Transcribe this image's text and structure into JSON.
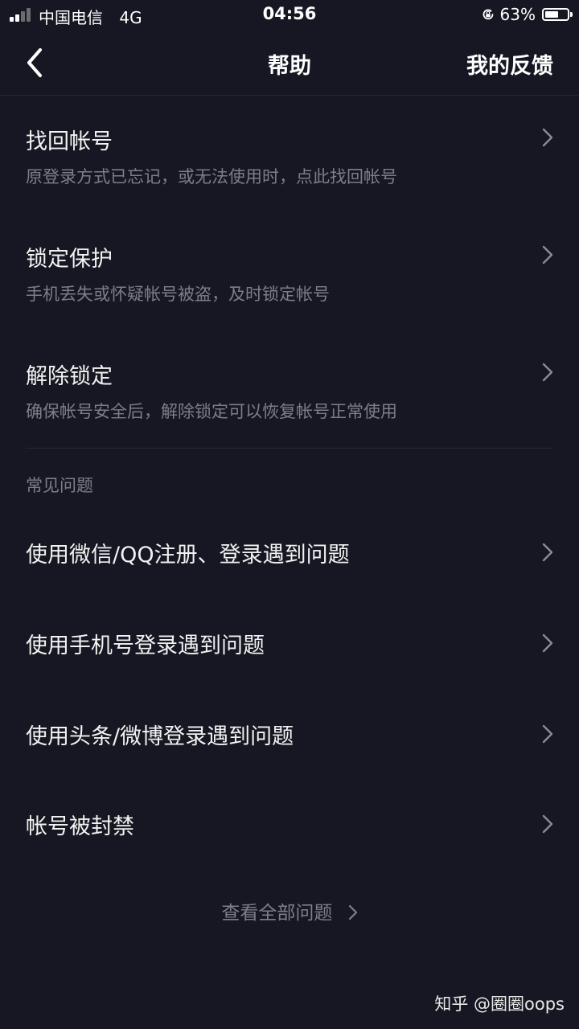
{
  "status_bar": {
    "carrier": "中国电信",
    "network": "4G",
    "time": "04:56",
    "battery_percent": "63%",
    "battery_level": 0.63,
    "signal_bars_active": 2,
    "signal_bars_total": 4
  },
  "nav": {
    "title": "帮助",
    "back_icon": "chevron-left-icon",
    "feedback_label": "我的反馈"
  },
  "account_items": [
    {
      "title": "找回帐号",
      "subtitle": "原登录方式已忘记，或无法使用时，点此找回帐号"
    },
    {
      "title": "锁定保护",
      "subtitle": "手机丢失或怀疑帐号被盗，及时锁定帐号"
    },
    {
      "title": "解除锁定",
      "subtitle": "确保帐号安全后，解除锁定可以恢复帐号正常使用"
    }
  ],
  "faq": {
    "header": "常见问题",
    "items": [
      {
        "title": "使用微信/QQ注册、登录遇到问题"
      },
      {
        "title": "使用手机号登录遇到问题"
      },
      {
        "title": "使用头条/微博登录遇到问题"
      },
      {
        "title": "帐号被封禁"
      }
    ]
  },
  "view_all_label": "查看全部问题",
  "watermark": "知乎 @圈圈oops",
  "colors": {
    "background": "#161722",
    "primary_text": "#f2f2f2",
    "secondary_text": "#7d7e88",
    "divider": "#262733"
  }
}
